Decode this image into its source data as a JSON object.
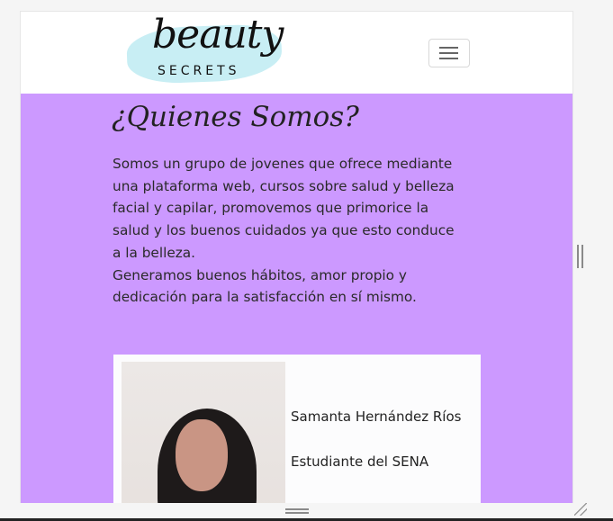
{
  "logo": {
    "title": "beauty",
    "subtitle": "SECRETS"
  },
  "navbar": {
    "toggle_icon": "hamburger-menu-icon"
  },
  "about": {
    "heading": "¿Quienes Somos?",
    "body": "Somos un grupo de jovenes que ofrece mediante una plataforma web, cursos sobre salud y belleza facial y capilar, promovemos que primorice la salud y los buenos cuidados ya que esto conduce a la belleza.\nGeneramos buenos hábitos, amor propio y dedicación para la satisfacción en sí mismo.",
    "background_color": "#cc99ff"
  },
  "member_card": {
    "name": "Samanta Hernández Ríos",
    "role": "Estudiante del SENA"
  }
}
